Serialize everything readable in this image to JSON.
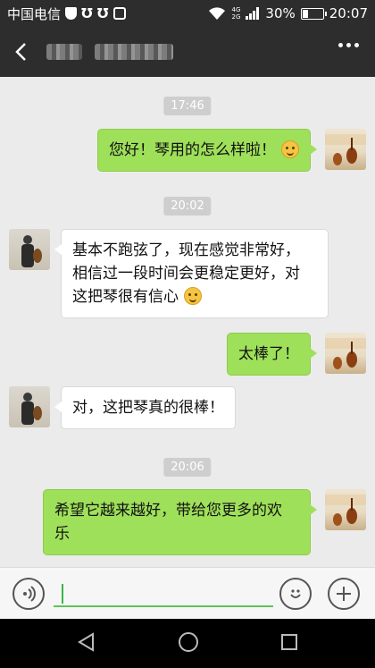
{
  "status_bar": {
    "carrier": "中国电信",
    "network_tag_top": "4G",
    "network_tag_bottom": "2G",
    "battery": "30%",
    "battery_level": 0.3,
    "time": "20:07"
  },
  "header": {
    "back_icon": "chevron-left-icon",
    "more_icon": "more-horizontal-icon"
  },
  "messages": {
    "t1": "17:46",
    "m1": "您好！琴用的怎么样啦！",
    "t2": "20:02",
    "m2_line1": "基本不跑弦了，现在感觉非常好，",
    "m2_line2": "相信过一段时间会更稳定更好，对",
    "m2_line3": "这把琴很有信心",
    "m3": "太棒了！",
    "m4": "对，这把琴真的很棒！",
    "t3": "20:06",
    "m5_line1": "希望它越来越好，带给您更多的欢",
    "m5_line2": "乐"
  },
  "input_bar": {
    "voice_icon": "voice-icon",
    "emoji_icon": "emoji-icon",
    "add_icon": "plus-icon",
    "value": ""
  },
  "nav_bar": {
    "back_icon": "triangle-back-icon",
    "home_icon": "circle-home-icon",
    "recents_icon": "square-recents-icon"
  },
  "colors": {
    "bubble_self": "#9fe05a",
    "bubble_other": "#ffffff",
    "title_bar": "#2d2d2d",
    "accent": "#5fc35a"
  }
}
